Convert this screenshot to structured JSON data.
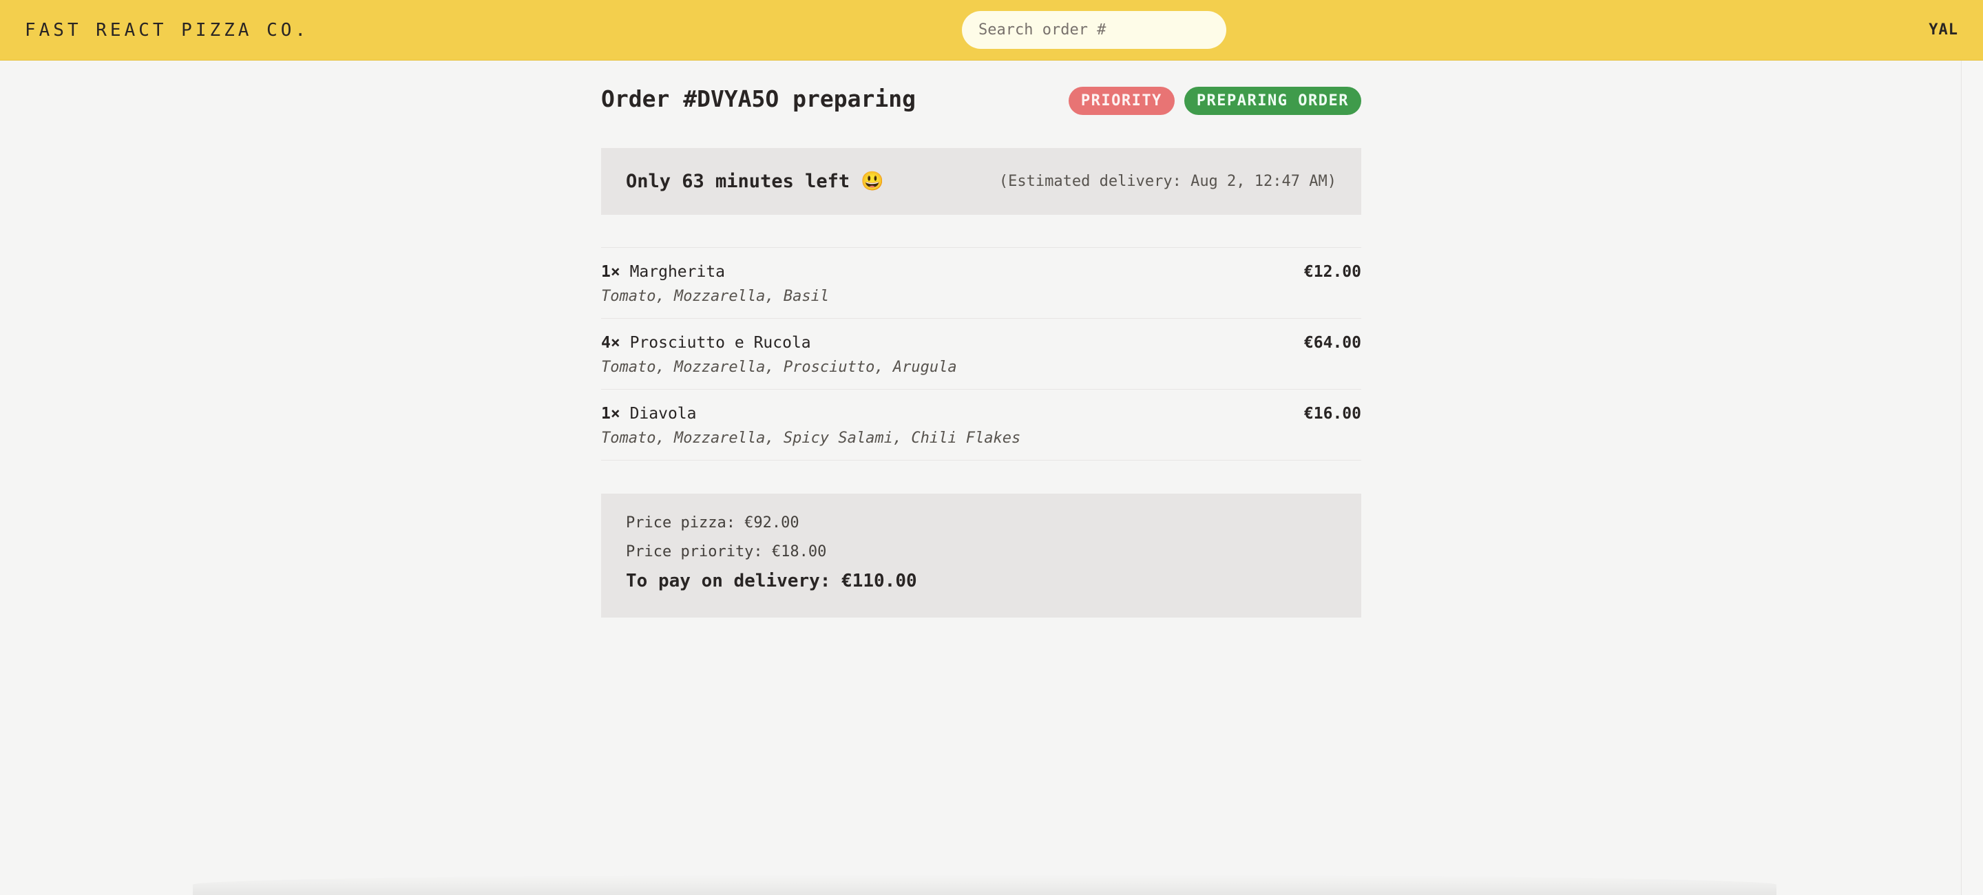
{
  "header": {
    "logo": "FAST REACT PIZZA CO.",
    "search_placeholder": "Search order #",
    "username": "YAL"
  },
  "order": {
    "title": "Order #DVYA5O preparing",
    "badges": {
      "priority": "PRIORITY",
      "status": "PREPARING ORDER"
    },
    "eta": {
      "left": "Only 63 minutes left 😃",
      "right": "(Estimated delivery: Aug 2, 12:47 AM)"
    },
    "items": [
      {
        "quantity": "1×",
        "name": "Margherita",
        "price": "€12.00",
        "ingredients": "Tomato, Mozzarella, Basil"
      },
      {
        "quantity": "4×",
        "name": "Prosciutto e Rucola",
        "price": "€64.00",
        "ingredients": "Tomato, Mozzarella, Prosciutto, Arugula"
      },
      {
        "quantity": "1×",
        "name": "Diavola",
        "price": "€16.00",
        "ingredients": "Tomato, Mozzarella, Spicy Salami, Chili Flakes"
      }
    ],
    "summary": {
      "price_pizza": "Price pizza: €92.00",
      "price_priority": "Price priority: €18.00",
      "total": "To pay on delivery: €110.00"
    }
  },
  "colors": {
    "header_bg": "#f3cf4d",
    "page_bg": "#f5f5f4",
    "panel_bg": "#e7e5e4",
    "priority_badge": "#e87474",
    "status_badge": "#3f9b4b"
  }
}
